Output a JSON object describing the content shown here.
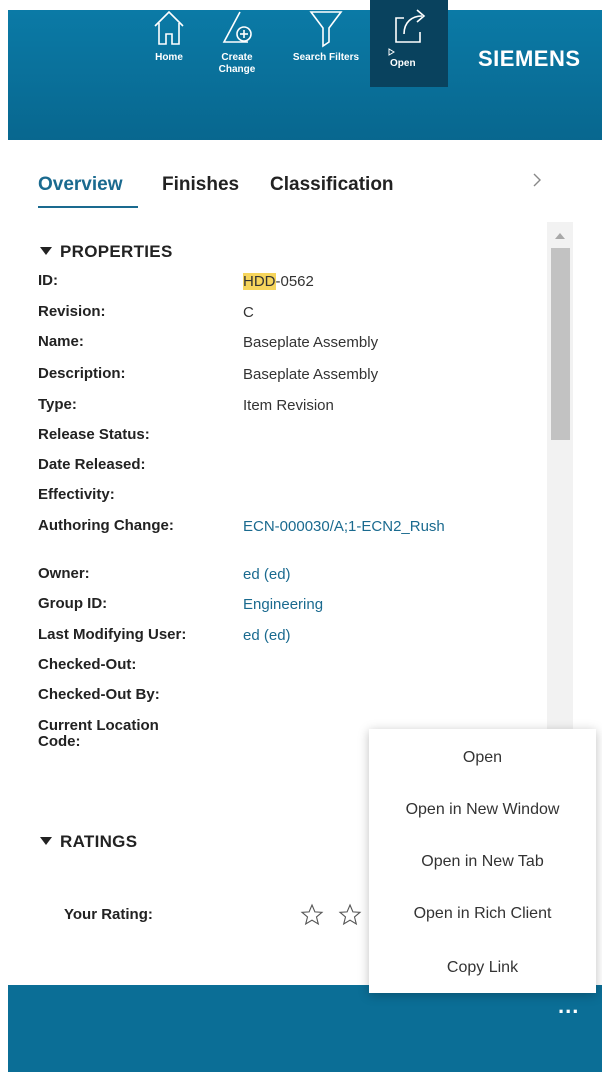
{
  "header": {
    "brand": "SIEMENS",
    "search_icon": "search-icon"
  },
  "tabs": [
    {
      "label": "Overview",
      "active": true
    },
    {
      "label": "Finishes",
      "active": false
    },
    {
      "label": "Classification",
      "active": false
    }
  ],
  "properties": {
    "title": "PROPERTIES",
    "rows": [
      {
        "label": "ID:",
        "value_highlight": "HDD",
        "value": "-0562"
      },
      {
        "label": "Revision:",
        "value": "C"
      },
      {
        "label": "Name:",
        "value": "Baseplate Assembly"
      },
      {
        "label": "Description:",
        "value": "Baseplate Assembly"
      },
      {
        "label": "Type:",
        "value": "Item Revision"
      },
      {
        "label": "Release Status:",
        "value": ""
      },
      {
        "label": "Date Released:",
        "value": ""
      },
      {
        "label": "Effectivity:",
        "value": ""
      },
      {
        "label": "Authoring Change:",
        "value": "ECN-000030/A;1-ECN2_Rush"
      },
      {
        "label": "Owner:",
        "value": "ed (ed)"
      },
      {
        "label": "Group ID:",
        "value": "Engineering"
      },
      {
        "label": "Last Modifying User:",
        "value": "ed (ed)"
      },
      {
        "label": "Checked-Out:",
        "value": ""
      },
      {
        "label": "Checked-Out By:",
        "value": ""
      },
      {
        "label": "Current Location Code:",
        "value": ""
      }
    ]
  },
  "ratings": {
    "title": "RATINGS",
    "your_rating_label": "Your Rating:",
    "stars": 0
  },
  "context_menu": {
    "items": [
      "Open",
      "Open in New Window",
      "Open in New Tab",
      "Open in Rich Client",
      "Copy Link"
    ]
  },
  "footer": {
    "buttons": [
      {
        "label": "Home",
        "icon": "home-icon"
      },
      {
        "label": "Create Change",
        "label_line1": "Create",
        "label_line2": "Change",
        "icon": "create-change-icon"
      },
      {
        "label": "Search Filters",
        "icon": "filter-icon"
      },
      {
        "label": "Open",
        "icon": "open-icon",
        "active": true
      }
    ],
    "more": "..."
  },
  "colors": {
    "header_bg": "#0b7aa6",
    "footer_bg": "#0b6e96",
    "accent": "#1a6a8f",
    "highlight": "#f6d55c"
  }
}
